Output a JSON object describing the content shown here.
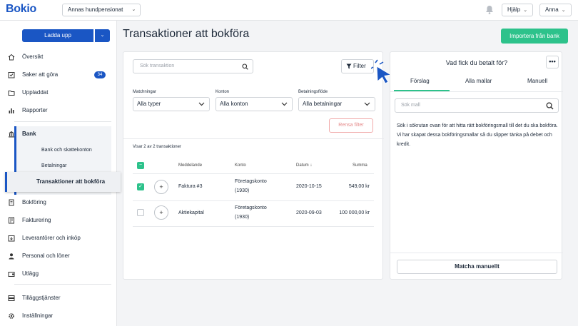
{
  "header": {
    "logo": "Bokio",
    "company": "Annas hundpensionat",
    "help_label": "Hjälp",
    "user_label": "Anna",
    "icons": {
      "bell": "bell-icon",
      "chevron": "chevron-down-icon"
    }
  },
  "sidebar": {
    "upload_label": "Ladda upp",
    "items": [
      {
        "label": "Översikt",
        "icon": "home-icon"
      },
      {
        "label": "Saker att göra",
        "icon": "todo-icon",
        "badge": "34"
      },
      {
        "label": "Uppladdat",
        "icon": "folder-icon"
      },
      {
        "label": "Rapporter",
        "icon": "bar-chart-icon"
      },
      {
        "label": "Bank",
        "icon": "bank-icon"
      },
      {
        "label": "Bokföring",
        "icon": "document-icon"
      },
      {
        "label": "Fakturering",
        "icon": "invoice-icon"
      },
      {
        "label": "Leverantörer och inköp",
        "icon": "supplier-icon"
      },
      {
        "label": "Personal och löner",
        "icon": "person-icon"
      },
      {
        "label": "Utlägg",
        "icon": "wallet-icon"
      },
      {
        "label": "Tilläggstjänster",
        "icon": "addon-icon"
      },
      {
        "label": "Inställningar",
        "icon": "gear-icon"
      }
    ],
    "bank_sub": [
      "Bank och skattekonton",
      "Betalningar"
    ],
    "active_label": "Transaktioner att bokföra"
  },
  "main": {
    "title": "Transaktioner att bokföra",
    "import_label": "Importera från bank",
    "search_placeholder": "Sök transaktion",
    "filter_label": "Filter",
    "filters": [
      {
        "label": "Matchningar",
        "value": "Alla typer"
      },
      {
        "label": "Konton",
        "value": "Alla konton"
      },
      {
        "label": "Betalningsflöde",
        "value": "Alla betalningar"
      }
    ],
    "reset_label": "Rensa filter",
    "count_text": "Visar 2 av 2 transaktioner",
    "columns": {
      "message": "Meddelande",
      "account": "Konto",
      "date": "Datum ↓",
      "sum": "Summa"
    },
    "rows": [
      {
        "checked": true,
        "message": "Faktura #3",
        "account_line1": "Företagskonto",
        "account_line2": "(1930)",
        "date": "2020-10-15",
        "sum": "549,00 kr"
      },
      {
        "checked": false,
        "message": "Aktiekapital",
        "account_line1": "Företagskonto",
        "account_line2": "(1930)",
        "date": "2020-09-03",
        "sum": "100 000,00 kr"
      }
    ]
  },
  "right": {
    "title": "Vad fick du betalt för?",
    "more_label": "•••",
    "tabs": [
      "Förslag",
      "Alla mallar",
      "Manuell"
    ],
    "search_placeholder": "Sök mall",
    "help_text": "Sök i sökrutan ovan för att hitta rätt bokföringsmall till det du ska bokföra. Vi har skapat dessa bokföringsmallar så du slipper tänka på debet och kredit.",
    "match_label": "Matcha manuellt"
  },
  "colors": {
    "brand": "#1a56c4",
    "success": "#2dc28b",
    "danger_soft": "#e58a8a"
  }
}
